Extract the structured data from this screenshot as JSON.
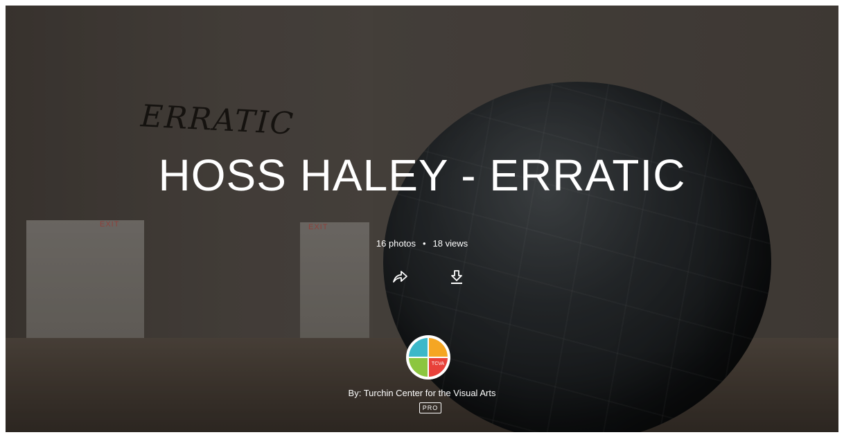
{
  "album": {
    "title": "HOSS HALEY - ERRATIC",
    "photos": "16 photos",
    "separator": "•",
    "views": "18 views"
  },
  "scene": {
    "wall_text": "ERRATIC",
    "exit_sign_left": "EXIT",
    "exit_sign_mid": "EXIT"
  },
  "actions": {
    "share_icon": "share-arrow-icon",
    "download_icon": "download-icon"
  },
  "owner": {
    "byline": "By: Turchin Center for the Visual Arts",
    "badge": "PRO",
    "avatar_text": "TCVA",
    "avatar_colors": [
      "#f5a623",
      "#e8413a",
      "#3bb8c9",
      "#8cc63f"
    ]
  }
}
